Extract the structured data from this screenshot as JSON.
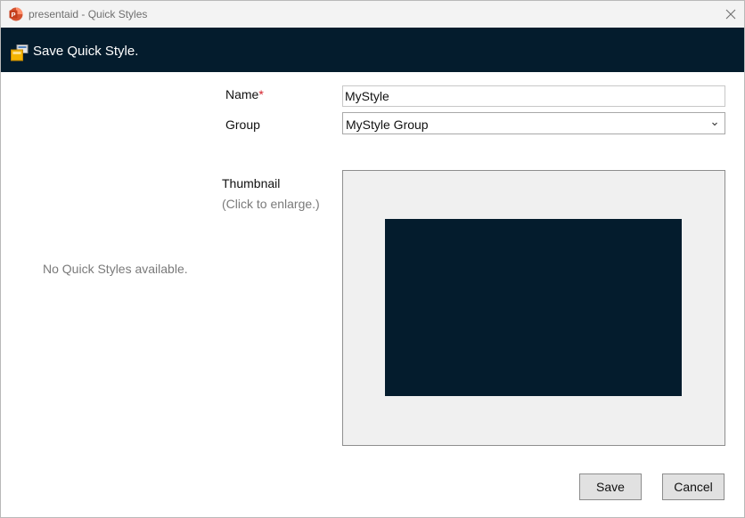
{
  "window": {
    "title": "presentaid - Quick Styles",
    "app_icon": "powerpoint-icon",
    "close_icon": "close-icon"
  },
  "header": {
    "title": "Save Quick Style.",
    "icon": "quick-style-save-icon"
  },
  "left_panel": {
    "empty_message": "No Quick Styles available."
  },
  "form": {
    "name_label": "Name",
    "required_marker": "*",
    "name_value": "MyStyle",
    "group_label": "Group",
    "group_value": "MyStyle Group",
    "group_chevron": "chevron-down-icon",
    "thumbnail_label": "Thumbnail",
    "thumbnail_hint": "(Click to enlarge.)"
  },
  "buttons": {
    "save": "Save",
    "cancel": "Cancel"
  },
  "colors": {
    "header_bg": "#041c2d",
    "thumbnail_slide": "#041c2d",
    "required": "#d4202a"
  }
}
